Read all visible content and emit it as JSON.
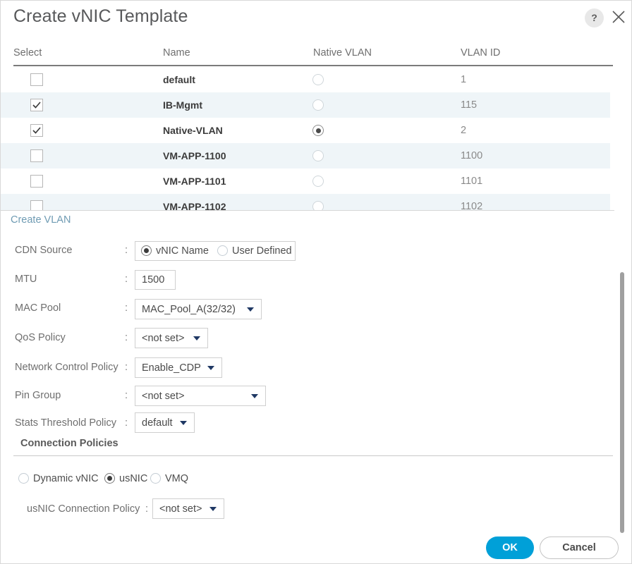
{
  "dialog": {
    "title": "Create vNIC Template",
    "help_label": "?",
    "close_label": "close-icon"
  },
  "vlan_table": {
    "columns": [
      "Select",
      "Name",
      "Native VLAN",
      "VLAN ID"
    ],
    "rows": [
      {
        "selected": false,
        "name": "default",
        "native": false,
        "vlan_id": "1"
      },
      {
        "selected": true,
        "name": "IB-Mgmt",
        "native": false,
        "vlan_id": "115"
      },
      {
        "selected": true,
        "name": "Native-VLAN",
        "native": true,
        "vlan_id": "2"
      },
      {
        "selected": false,
        "name": "VM-APP-1100",
        "native": false,
        "vlan_id": "1100"
      },
      {
        "selected": false,
        "name": "VM-APP-1101",
        "native": false,
        "vlan_id": "1101"
      },
      {
        "selected": false,
        "name": "VM-APP-1102",
        "native": false,
        "vlan_id": "1102"
      }
    ]
  },
  "create_vlan_link": "Create VLAN",
  "form": {
    "cdn_source": {
      "label": "CDN Source",
      "colon": ":",
      "options": [
        {
          "label": "vNIC Name",
          "selected": true
        },
        {
          "label": "User Defined",
          "selected": false
        }
      ]
    },
    "mtu": {
      "label": "MTU",
      "colon": ":",
      "value": "1500"
    },
    "mac_pool": {
      "label": "MAC Pool",
      "colon": ":",
      "value": "MAC_Pool_A(32/32)"
    },
    "qos_policy": {
      "label": "QoS Policy",
      "colon": ":",
      "value": "<not set>"
    },
    "network_control_policy": {
      "label": "Network Control Policy",
      "colon": ":",
      "value": "Enable_CDP"
    },
    "pin_group": {
      "label": "Pin Group",
      "colon": ":",
      "value": "<not set>"
    },
    "stats_threshold_policy": {
      "label": "Stats Threshold Policy",
      "colon": ":",
      "value": "default"
    }
  },
  "connection_policies": {
    "heading": "Connection Policies",
    "options": [
      {
        "label": "Dynamic vNIC",
        "selected": false
      },
      {
        "label": "usNIC",
        "selected": true
      },
      {
        "label": "VMQ",
        "selected": false
      }
    ],
    "usnic_connection_policy": {
      "label": "usNIC Connection Policy",
      "colon": ":",
      "value": "<not set>"
    }
  },
  "footer": {
    "ok_label": "OK",
    "cancel_label": "Cancel"
  },
  "colors": {
    "accent_blue": "#00a0d8",
    "link_blue": "#6f9bb3",
    "row_stripe": "#eff5f8",
    "arrow_navy": "#1f3864"
  }
}
